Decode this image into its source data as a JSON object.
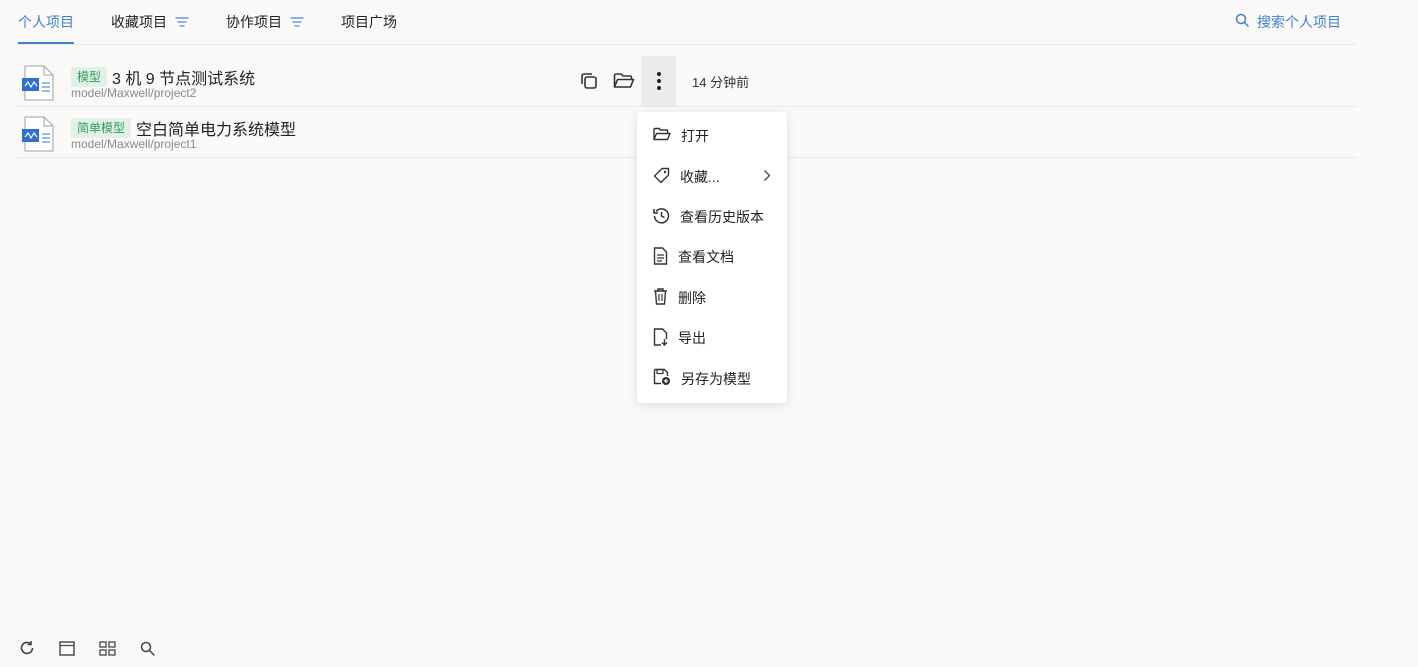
{
  "tabs": [
    {
      "label": "个人项目",
      "active": true,
      "filter": false
    },
    {
      "label": "收藏项目",
      "active": false,
      "filter": true
    },
    {
      "label": "协作项目",
      "active": false,
      "filter": true
    },
    {
      "label": "项目广场",
      "active": false,
      "filter": false
    }
  ],
  "search": {
    "label": "搜索个人项目",
    "icon": "search-icon"
  },
  "projects": [
    {
      "tag": "模型",
      "name": "3 机 9 节点测试系统",
      "path": "model/Maxwell/project2",
      "time": "14 分钟前"
    },
    {
      "tag": "简单模型",
      "name": "空白简单电力系统模型",
      "path": "model/Maxwell/project1"
    }
  ],
  "menu": {
    "items": [
      {
        "label": "打开",
        "icon": "folder-open-icon"
      },
      {
        "label": "收藏...",
        "icon": "tag-icon",
        "submenu": true
      },
      {
        "label": "查看历史版本",
        "icon": "history-icon"
      },
      {
        "label": "查看文档",
        "icon": "document-icon"
      },
      {
        "label": "删除",
        "icon": "trash-icon"
      },
      {
        "label": "导出",
        "icon": "export-icon"
      },
      {
        "label": "另存为模型",
        "icon": "save-as-icon"
      }
    ]
  },
  "colors": {
    "accent": "#3f7fd6",
    "tag_bg": "#e1f1e7",
    "tag_text": "#2e9c5a"
  },
  "bottom_toolbar": [
    "refresh-icon",
    "single-view-icon",
    "grid-view-icon",
    "search-icon"
  ]
}
